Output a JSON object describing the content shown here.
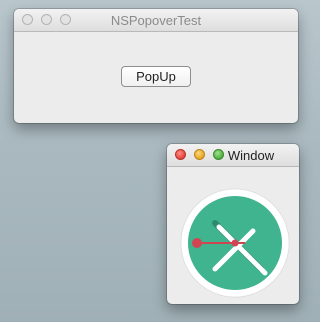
{
  "main_window": {
    "title": "NSPopoverTest",
    "popup_button_label": "PopUp"
  },
  "popover_window": {
    "title": "Window",
    "clock": {
      "face_color": "#3fb48f",
      "rim_color": "#ffffff",
      "hand_color": "#ffffff",
      "second_hand_color": "#d14451"
    }
  },
  "colors": {
    "desktop": "#a9b9bf",
    "window_bg": "#ececec"
  }
}
